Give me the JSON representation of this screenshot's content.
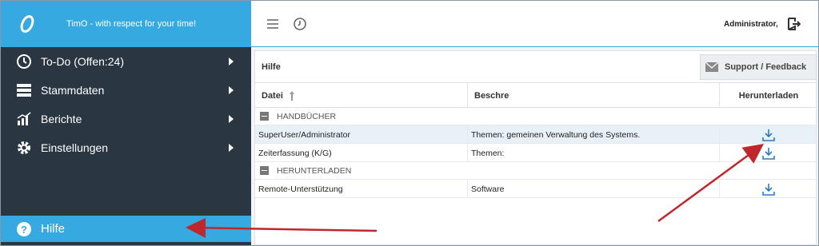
{
  "app": {
    "title": "TimO - with respect for your time!",
    "brand_color": "#36a9e1",
    "sidebar_color": "#2b3643"
  },
  "sidebar": {
    "items": [
      {
        "label": "To-Do (Offen:24)",
        "icon": "clock-icon"
      },
      {
        "label": "Stammdaten",
        "icon": "list-icon"
      },
      {
        "label": "Berichte",
        "icon": "chart-icon"
      },
      {
        "label": "Einstellungen",
        "icon": "gear-icon"
      }
    ],
    "help": {
      "label": "Hilfe",
      "icon": "question-icon"
    }
  },
  "topbar": {
    "user": "Administrator,"
  },
  "panel": {
    "title": "Hilfe",
    "support_label": "Support / Feedback",
    "columns": [
      "Datei",
      "Beschre",
      "Herunterladen"
    ],
    "groups": [
      {
        "name": "HANDBÜCHER",
        "rows": [
          {
            "file": "SuperUser/Administrator",
            "desc": "Themen: gemeinen Verwaltung des Systems."
          },
          {
            "file": "Zeiterfassung (K/G)",
            "desc": "Themen:"
          }
        ]
      },
      {
        "name": "HERUNTERLADEN",
        "rows": [
          {
            "file": "Remote-Unterstützung",
            "desc": "Software"
          }
        ]
      }
    ]
  },
  "annotation_color": "#c0272d"
}
